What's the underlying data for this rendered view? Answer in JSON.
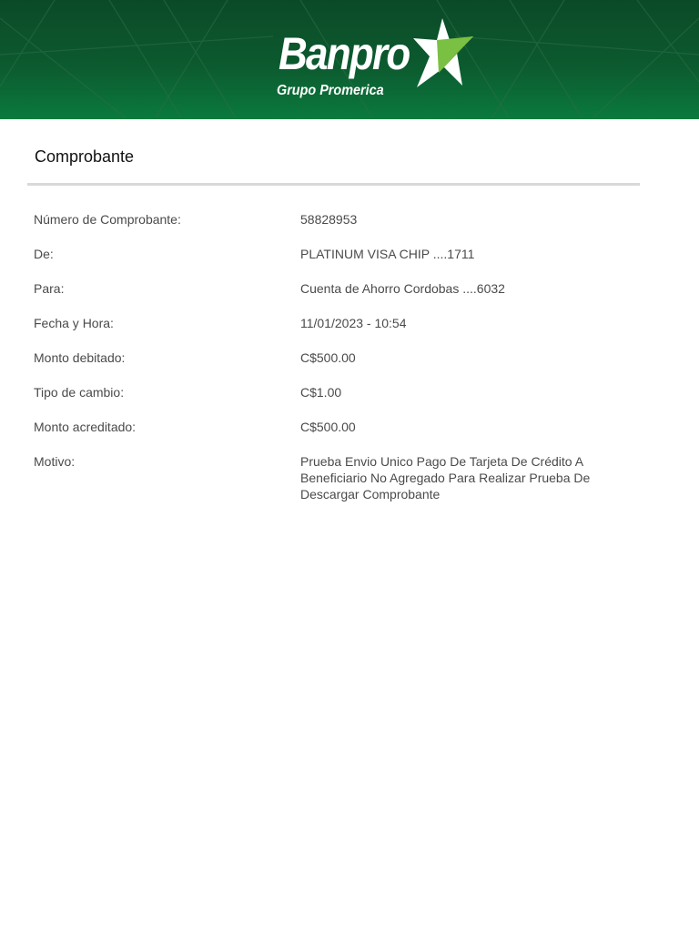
{
  "header": {
    "brand_name": "Banpro",
    "brand_sub": "Grupo Promerica",
    "colors": {
      "header_dark": "#0b4a27",
      "header_light": "#0a7a3d",
      "star_green": "#7ac143"
    }
  },
  "receipt": {
    "title": "Comprobante",
    "rows": [
      {
        "label": "Número de Comprobante:",
        "value": "58828953"
      },
      {
        "label": "De:",
        "value": "PLATINUM VISA CHIP ....1711"
      },
      {
        "label": "Para:",
        "value": "Cuenta de Ahorro Cordobas ....6032"
      },
      {
        "label": "Fecha y Hora:",
        "value": "11/01/2023 - 10:54"
      },
      {
        "label": "Monto debitado:",
        "value": "C$500.00"
      },
      {
        "label": "Tipo de cambio:",
        "value": "C$1.00"
      },
      {
        "label": "Monto acreditado:",
        "value": "C$500.00"
      },
      {
        "label": "Motivo:",
        "value": "Prueba Envio Unico Pago De Tarjeta De Crédito A Beneficiario No Agregado Para Realizar Prueba De Descargar Comprobante"
      }
    ]
  }
}
